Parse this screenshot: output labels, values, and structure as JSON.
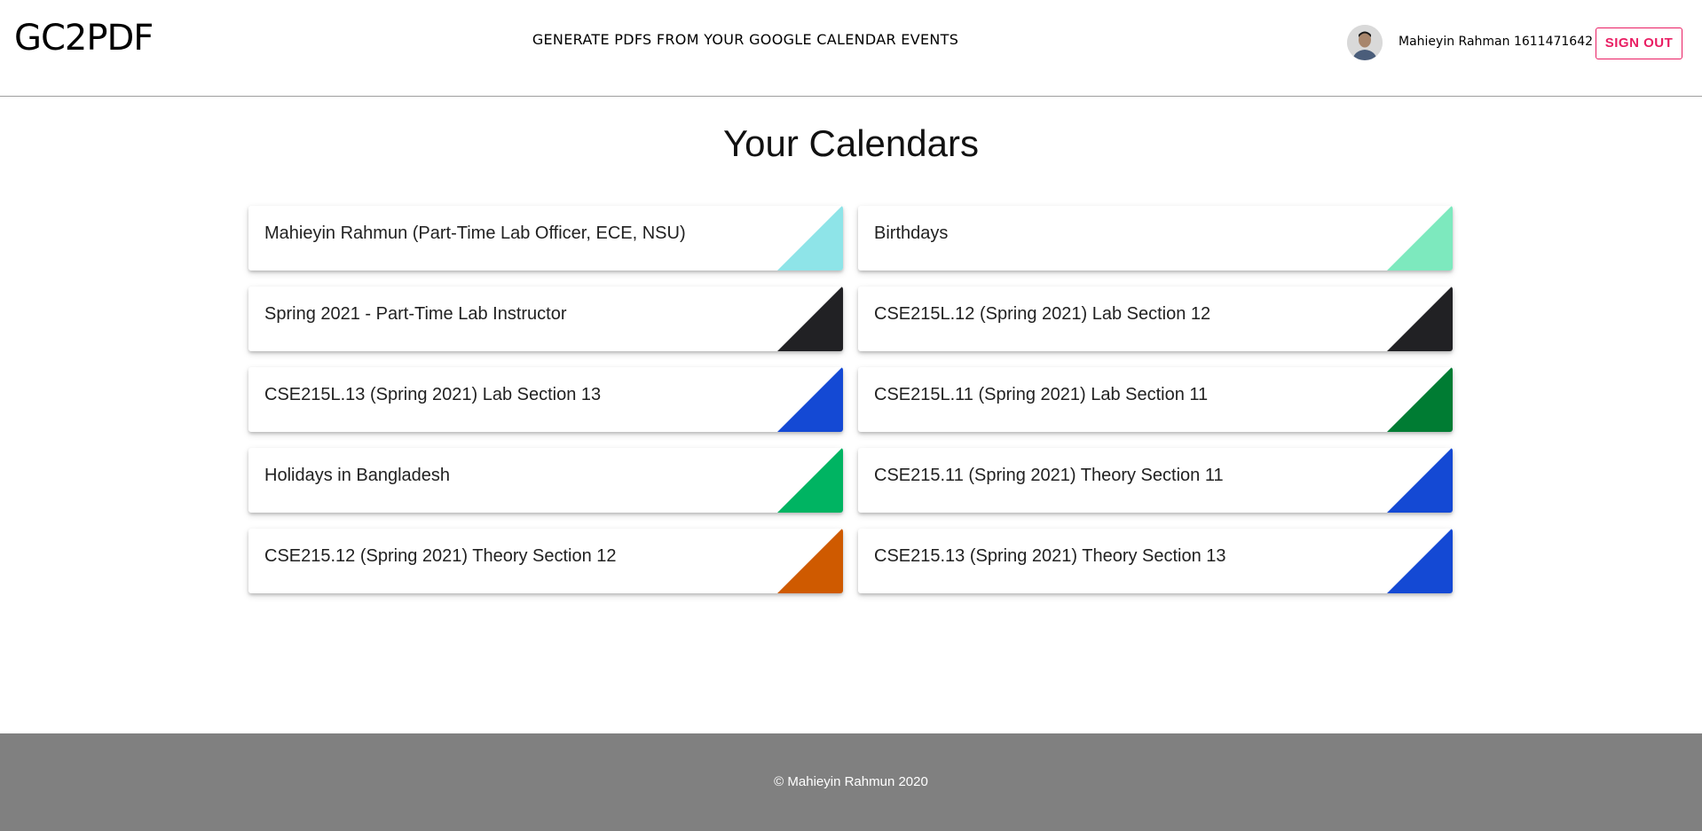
{
  "header": {
    "logo": "GC2PDF",
    "tagline": "GENERATE PDFS FROM YOUR GOOGLE CALENDAR EVENTS",
    "user_name": "Mahieyin Rahman 1611471642",
    "signout_label": "SIGN OUT"
  },
  "main": {
    "title": "Your Calendars",
    "calendars": [
      {
        "label": "Mahieyin Rahmun (Part-Time Lab Officer, ECE, NSU)",
        "color": "#8ee4e8"
      },
      {
        "label": "Birthdays",
        "color": "#7de9be"
      },
      {
        "label": "Spring 2021 - Part-Time Lab Instructor",
        "color": "#212124"
      },
      {
        "label": "CSE215L.12 (Spring 2021) Lab Section 12",
        "color": "#212124"
      },
      {
        "label": "CSE215L.13 (Spring 2021) Lab Section 13",
        "color": "#1449d4"
      },
      {
        "label": "CSE215L.11 (Spring 2021) Lab Section 11",
        "color": "#007c33"
      },
      {
        "label": "Holidays in Bangladesh",
        "color": "#00b462"
      },
      {
        "label": "CSE215.11 (Spring 2021) Theory Section 11",
        "color": "#1449d4"
      },
      {
        "label": "CSE215.12 (Spring 2021) Theory Section 12",
        "color": "#cf5a00"
      },
      {
        "label": "CSE215.13 (Spring 2021) Theory Section 13",
        "color": "#1449d4"
      }
    ]
  },
  "footer": {
    "copyright": "© Mahieyin Rahmun 2020"
  }
}
